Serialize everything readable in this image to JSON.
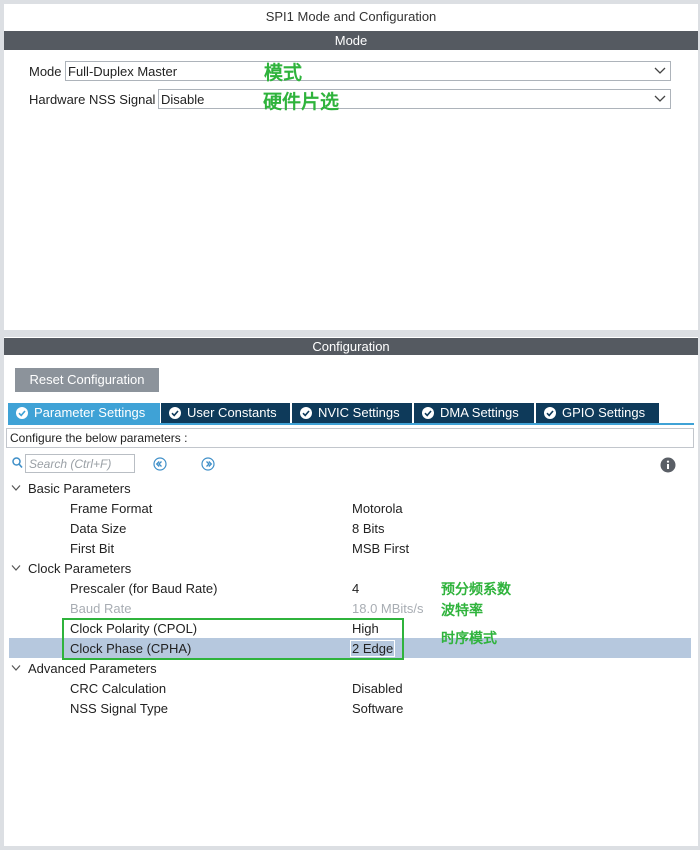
{
  "window": {
    "title": "SPI1 Mode and Configuration"
  },
  "mode_section": {
    "header": "Mode",
    "mode": {
      "label": "Mode",
      "value": "Full-Duplex Master",
      "annotation": "模式"
    },
    "nss": {
      "label": "Hardware NSS Signal",
      "value": "Disable",
      "annotation": "硬件片选"
    }
  },
  "config_section": {
    "header": "Configuration",
    "reset_button": "Reset Configuration",
    "tabs": [
      {
        "label": "Parameter Settings",
        "active": true
      },
      {
        "label": "User Constants",
        "active": false
      },
      {
        "label": "NVIC Settings",
        "active": false
      },
      {
        "label": "DMA Settings",
        "active": false
      },
      {
        "label": "GPIO Settings",
        "active": false
      }
    ],
    "hint": "Configure the below parameters :",
    "search": {
      "placeholder": "Search (Ctrl+F)"
    },
    "groups": [
      {
        "name": "Basic Parameters",
        "params": [
          {
            "name": "Frame Format",
            "value": "Motorola"
          },
          {
            "name": "Data Size",
            "value": "8 Bits"
          },
          {
            "name": "First Bit",
            "value": "MSB First"
          }
        ]
      },
      {
        "name": "Clock Parameters",
        "params": [
          {
            "name": "Prescaler (for Baud Rate)",
            "value": "4"
          },
          {
            "name": "Baud Rate",
            "value": "18.0 MBits/s",
            "disabled": true
          },
          {
            "name": "Clock Polarity (CPOL)",
            "value": "High"
          },
          {
            "name": "Clock Phase (CPHA)",
            "value": "2 Edge",
            "selected": true
          }
        ]
      },
      {
        "name": "Advanced Parameters",
        "params": [
          {
            "name": "CRC Calculation",
            "value": "Disabled"
          },
          {
            "name": "NSS Signal Type",
            "value": "Software"
          }
        ]
      }
    ],
    "annotations": {
      "prescaler": "预分频系数",
      "baud_rate": "波特率",
      "timing_mode": "时序模式"
    }
  },
  "colors": {
    "section_bar": "#555a61",
    "tab_active": "#3fa2d6",
    "tab_inactive": "#0e3a5a",
    "annotation_green": "#2fb33c",
    "selected_row": "#b6c8de"
  }
}
